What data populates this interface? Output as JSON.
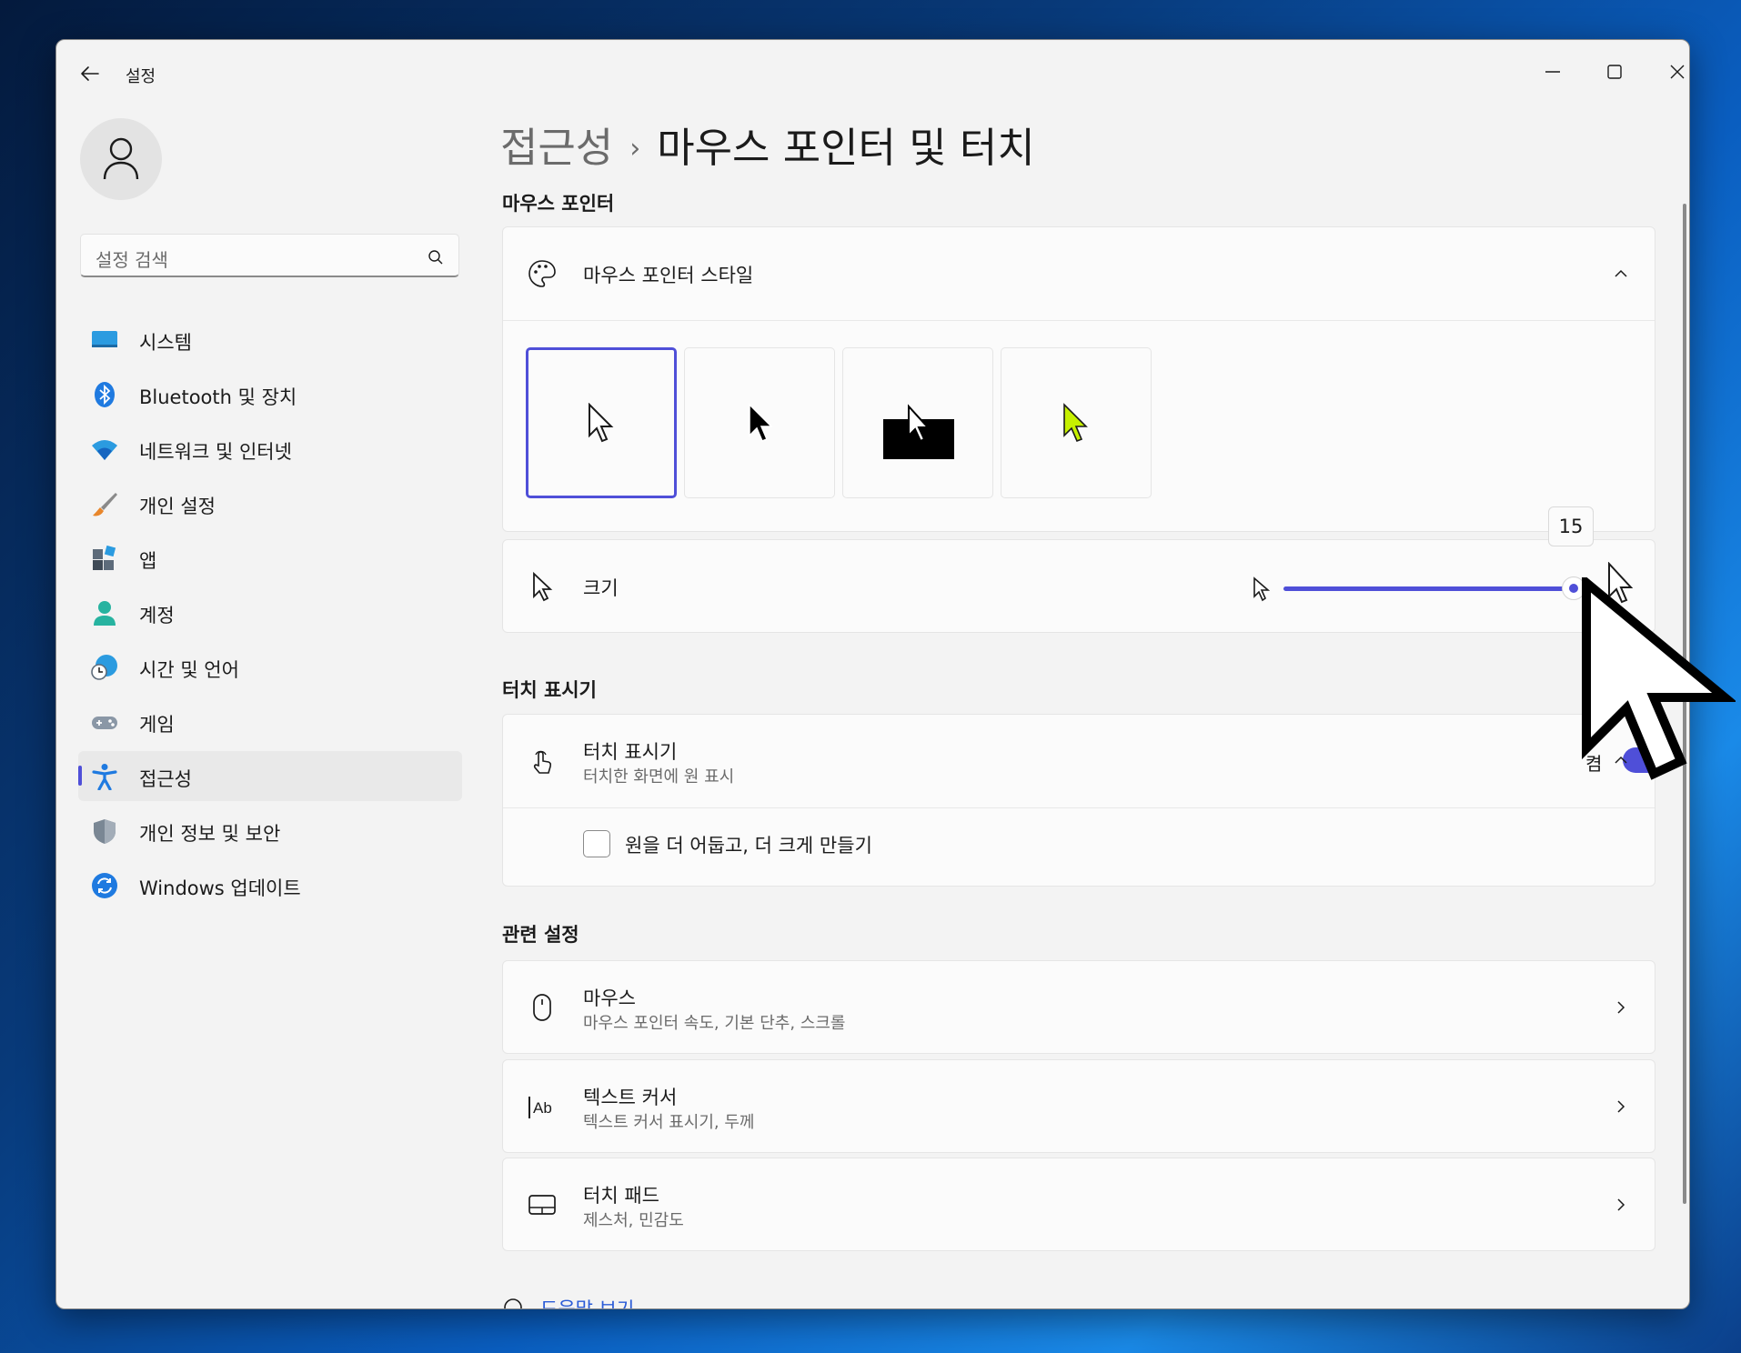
{
  "window": {
    "title": "설정"
  },
  "search": {
    "placeholder": "설정 검색"
  },
  "sidebar": {
    "items": [
      {
        "label": "시스템",
        "icon": "monitor-icon"
      },
      {
        "label": "Bluetooth 및 장치",
        "icon": "bluetooth-icon"
      },
      {
        "label": "네트워크 및 인터넷",
        "icon": "wifi-icon"
      },
      {
        "label": "개인 설정",
        "icon": "brush-icon"
      },
      {
        "label": "앱",
        "icon": "apps-icon"
      },
      {
        "label": "계정",
        "icon": "person-icon"
      },
      {
        "label": "시간 및 언어",
        "icon": "globe-clock-icon"
      },
      {
        "label": "게임",
        "icon": "gamepad-icon"
      },
      {
        "label": "접근성",
        "icon": "accessibility-icon",
        "active": true
      },
      {
        "label": "개인 정보 및 보안",
        "icon": "shield-icon"
      },
      {
        "label": "Windows 업데이트",
        "icon": "update-icon"
      }
    ]
  },
  "breadcrumb": {
    "parent": "접근성",
    "separator": "›",
    "current": "마우스 포인터 및 터치"
  },
  "mouse_pointer": {
    "section_title": "마우스 포인터",
    "style": {
      "title": "마우스 포인터 스타일",
      "selected_index": 0,
      "options": [
        "white",
        "black",
        "inverted",
        "custom-lime"
      ]
    },
    "size": {
      "title": "크기",
      "value": "15",
      "fraction": 1.0
    }
  },
  "touch_indicator": {
    "section_title": "터치 표시기",
    "title": "터치 표시기",
    "subtitle": "터치한 화면에 원 표시",
    "state_label": "켬",
    "toggle_on": true,
    "option_label": "원을 더 어둡고, 더 크게 만들기",
    "option_checked": false
  },
  "related": {
    "section_title": "관련 설정",
    "items": [
      {
        "title": "마우스",
        "subtitle": "마우스 포인터 속도, 기본 단추, 스크롤"
      },
      {
        "title": "텍스트 커서",
        "subtitle": "텍스트 커서 표시기, 두께"
      },
      {
        "title": "터치 패드",
        "subtitle": "제스처, 민감도"
      }
    ]
  },
  "help": {
    "label": "도움말 보기"
  },
  "colors": {
    "accent": "#4f4fd8",
    "lime": "#c6f000"
  }
}
